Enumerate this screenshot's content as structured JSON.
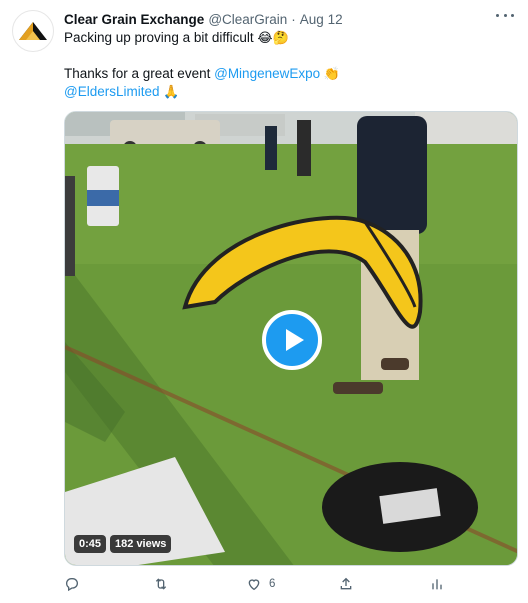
{
  "tweet": {
    "author_name": "Clear Grain Exchange",
    "author_handle": "@ClearGrain",
    "separator": "·",
    "date": "Aug 12",
    "line1_text": "Packing up proving a bit difficult",
    "line1_emojis": "😂🤔",
    "line2_text": "Thanks for a great event",
    "line2_mention": "@MingenewExpo",
    "line2_emoji": "👏",
    "line3_mention": "@EldersLimited",
    "line3_emoji": "🙏"
  },
  "video": {
    "duration": "0:45",
    "views": "182 views"
  },
  "actions": {
    "reply_count": "",
    "retweet_count": "",
    "like_count": "6",
    "share_count": "",
    "analytics_count": ""
  },
  "colors": {
    "accent": "#1d9bf0",
    "secondary_text": "#536471",
    "grass": "#6f9b3e",
    "banner_yellow": "#f4c61b"
  },
  "icons": [
    "avatar-logo",
    "more-icon",
    "play-icon",
    "reply-icon",
    "retweet-icon",
    "like-icon",
    "share-icon",
    "analytics-icon"
  ]
}
